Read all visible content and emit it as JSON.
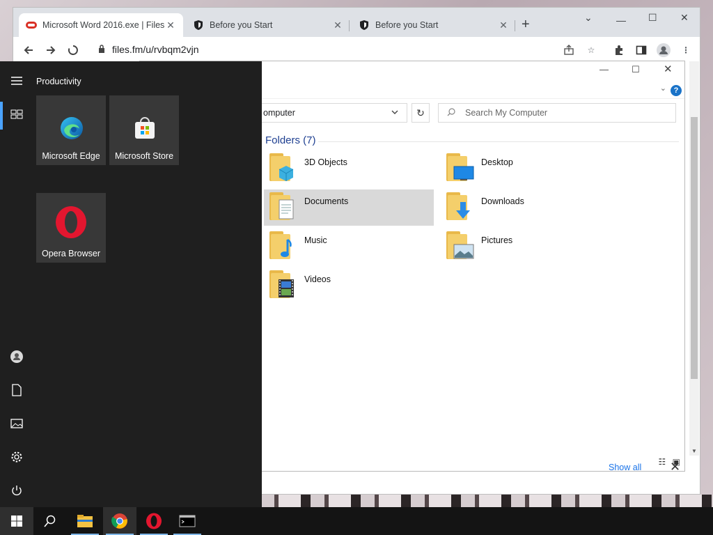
{
  "browser": {
    "tabs": [
      {
        "title": "Microsoft Word 2016.exe | Files.f",
        "active": true
      },
      {
        "title": "Before you Start",
        "active": false
      },
      {
        "title": "Before you Start",
        "active": false
      }
    ],
    "url": "files.fm/u/rvbqm2vjn"
  },
  "explorer": {
    "address": "omputer",
    "search_placeholder": "Search My Computer",
    "group_header": "Folders (7)",
    "folders": [
      {
        "name": "3D Objects",
        "icon": "3d-objects-folder-icon"
      },
      {
        "name": "Desktop",
        "icon": "desktop-folder-icon"
      },
      {
        "name": "Documents",
        "icon": "documents-folder-icon",
        "selected": true
      },
      {
        "name": "Downloads",
        "icon": "downloads-folder-icon"
      },
      {
        "name": "Music",
        "icon": "music-folder-icon"
      },
      {
        "name": "Pictures",
        "icon": "pictures-folder-icon"
      },
      {
        "name": "Videos",
        "icon": "videos-folder-icon"
      }
    ]
  },
  "download_bar": {
    "show_all": "Show all"
  },
  "start_menu": {
    "group": "Productivity",
    "tiles": [
      {
        "label": "Microsoft Edge"
      },
      {
        "label": "Microsoft Store"
      },
      {
        "label": "Opera Browser"
      }
    ]
  },
  "colors": {
    "accent": "#4aa3ff",
    "group_header": "#1e3f91",
    "start_bg": "#1f1f1f",
    "taskbar_bg": "#141414"
  }
}
